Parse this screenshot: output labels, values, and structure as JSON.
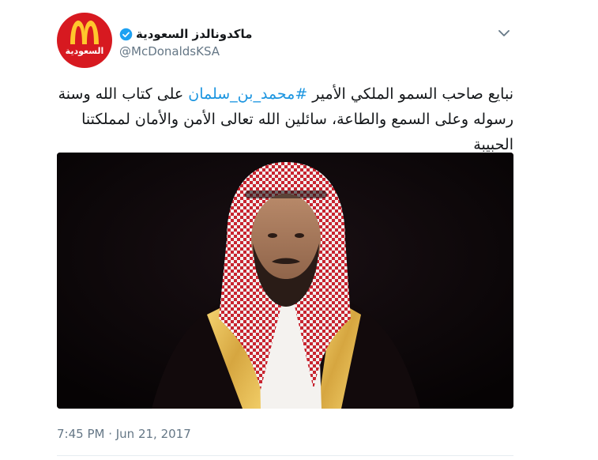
{
  "author": {
    "display_name": "ماكدونالدز السعودية",
    "handle": "@McDonaldsKSA",
    "verified": true,
    "avatar_text": "السعودية"
  },
  "tweet": {
    "text_part1": "نبايع صاحب السمو الملكي الأمير ",
    "hashtag": "#محمد_بن_سلمان",
    "text_part2": " على كتاب الله وسنة رسوله وعلى السمع والطاعة، سائلين الله تعالى الأمن والأمان لمملكتنا الحبيبة",
    "timestamp": "7:45 PM · Jun 21, 2017"
  },
  "colors": {
    "link": "#1b95e0",
    "verified": "#1da1f2",
    "brand_red": "#d71920",
    "brand_yellow": "#ffc72c"
  },
  "icons": {
    "verified": "verified-icon",
    "menu": "chevron-down-icon",
    "logo": "golden-arches-logo"
  }
}
